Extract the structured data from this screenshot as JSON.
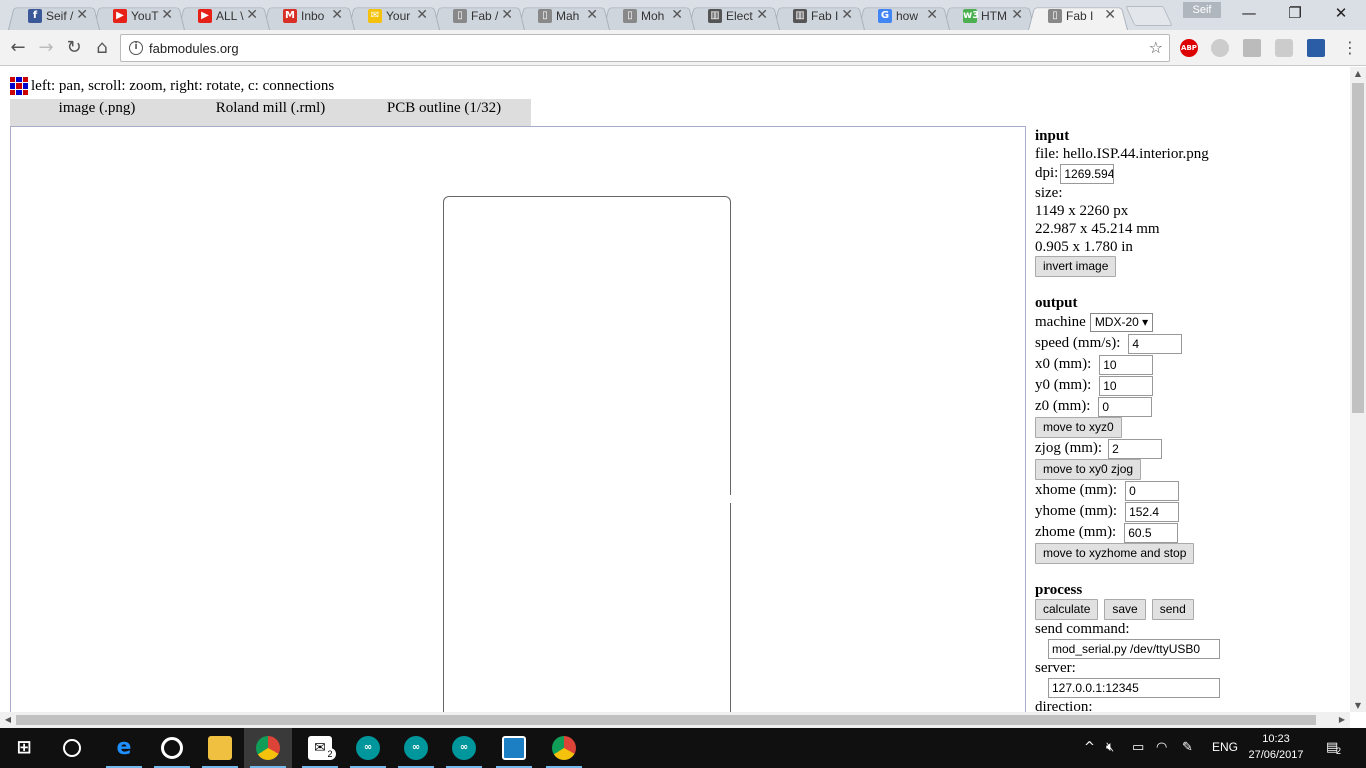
{
  "browser": {
    "tabs": [
      {
        "label": "Seif /",
        "icon": "facebook-icon",
        "color": "#3b5998",
        "glyph": "f"
      },
      {
        "label": "YouT",
        "icon": "youtube-icon",
        "color": "#e62117",
        "glyph": "▶"
      },
      {
        "label": "ALL \\",
        "icon": "youtube-icon",
        "color": "#e62117",
        "glyph": "▶"
      },
      {
        "label": "Inbo",
        "icon": "gmail-icon",
        "color": "#d93025",
        "glyph": "M"
      },
      {
        "label": "Your",
        "icon": "folder-icon",
        "color": "#f4c20d",
        "glyph": "✉"
      },
      {
        "label": "Fab /",
        "icon": "page-icon",
        "color": "#888888",
        "glyph": "▯"
      },
      {
        "label": "Mah",
        "icon": "page-icon",
        "color": "#888888",
        "glyph": "▯"
      },
      {
        "label": "Moh",
        "icon": "page-icon",
        "color": "#888888",
        "glyph": "▯"
      },
      {
        "label": "Elect",
        "icon": "book-icon",
        "color": "#555555",
        "glyph": "▥"
      },
      {
        "label": "Fab I",
        "icon": "book-icon",
        "color": "#555555",
        "glyph": "▥"
      },
      {
        "label": "how",
        "icon": "google-icon",
        "color": "#4285f4",
        "glyph": "G"
      },
      {
        "label": "HTM",
        "icon": "w3schools-icon",
        "color": "#4caf50",
        "glyph": "w3"
      },
      {
        "label": "Fab I",
        "icon": "page-icon",
        "color": "#888888",
        "glyph": "▯",
        "active": true
      }
    ],
    "profile": "Seif",
    "url": "fabmodules.org"
  },
  "page": {
    "hint": "left: pan, scroll: zoom, right: rotate, c: connections",
    "module_tabs": [
      "image (.png)",
      "Roland mill (.rml)",
      "PCB outline (1/32)"
    ],
    "input": {
      "heading": "input",
      "file_label": "file:",
      "file_name": "hello.ISP.44.interior.png",
      "dpi_label": "dpi:",
      "dpi_value": "1269.594",
      "size_label": "size:",
      "size_px": "1149 x 2260 px",
      "size_mm": "22.987 x 45.214 mm",
      "size_in": "0.905 x 1.780 in",
      "invert_button": "invert image"
    },
    "output": {
      "heading": "output",
      "machine_label": "machine",
      "machine_value": "MDX-20 ▾",
      "speed_label": "speed (mm/s):",
      "speed_value": "4",
      "x0_label": "x0 (mm):",
      "x0_value": "10",
      "y0_label": "y0 (mm):",
      "y0_value": "10",
      "z0_label": "z0 (mm):",
      "z0_value": "0",
      "move_xyz0_button": "move to xyz0",
      "zjog_label": "zjog (mm):",
      "zjog_value": "2",
      "move_xy0_button": "move to xy0 zjog",
      "xhome_label": "xhome (mm):",
      "xhome_value": "0",
      "yhome_label": "yhome (mm):",
      "yhome_value": "152.4",
      "zhome_label": "zhome (mm):",
      "zhome_value": "60.5",
      "move_home_button": "move to xyzhome and stop"
    },
    "process": {
      "heading": "process",
      "calculate_button": "calculate",
      "save_button": "save",
      "send_button": "send",
      "send_command_label": "send command:",
      "send_command_value": "mod_serial.py /dev/ttyUSB0",
      "server_label": "server:",
      "server_value": "127.0.0.1:12345",
      "direction_label": "direction:"
    }
  },
  "taskbar": {
    "language": "ENG",
    "time": "10:23",
    "date": "27/06/2017",
    "notifications": "2",
    "mail_badge": "2"
  },
  "colors": {
    "logo": [
      "#cc0000",
      "#0000cc",
      "#cc0000",
      "#0000cc",
      "#cc0000",
      "#0000cc",
      "#cc0000",
      "#0000cc",
      "#cc0000"
    ]
  }
}
